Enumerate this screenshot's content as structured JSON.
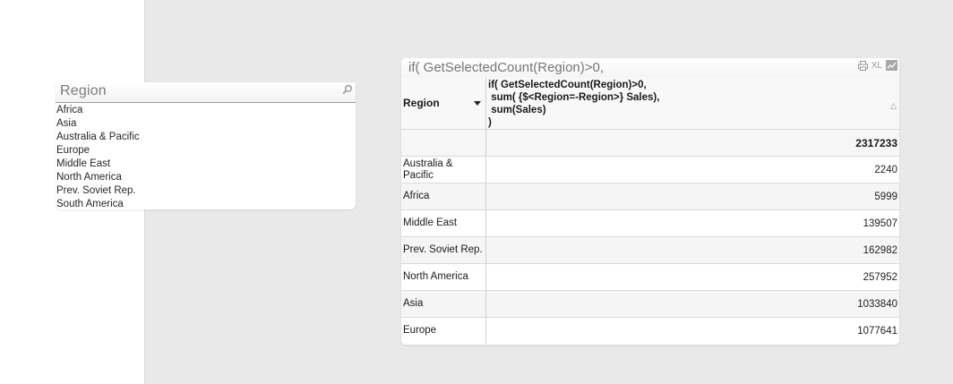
{
  "listbox": {
    "title": "Region",
    "items": [
      "Africa",
      "Asia",
      "Australia & Pacific",
      "Europe",
      "Middle East",
      "North America",
      "Prev. Soviet Rep.",
      "South America"
    ]
  },
  "table": {
    "caption": "if( GetSelectedCount(Region)>0,",
    "icons": {
      "xl_label": "XL"
    },
    "header": {
      "col1": "Region",
      "col2_lines": [
        "if( GetSelectedCount(Region)>0,",
        " sum( {$<Region=-Region>} Sales),",
        " sum(Sales)",
        ")"
      ]
    },
    "total": "2317233",
    "rows": [
      {
        "region": "Australia & Pacific",
        "value": "2240"
      },
      {
        "region": "Africa",
        "value": "5999"
      },
      {
        "region": "Middle East",
        "value": "139507"
      },
      {
        "region": "Prev. Soviet Rep.",
        "value": "162982"
      },
      {
        "region": "North America",
        "value": "257952"
      },
      {
        "region": "Asia",
        "value": "1033840"
      },
      {
        "region": "Europe",
        "value": "1077641"
      }
    ]
  }
}
